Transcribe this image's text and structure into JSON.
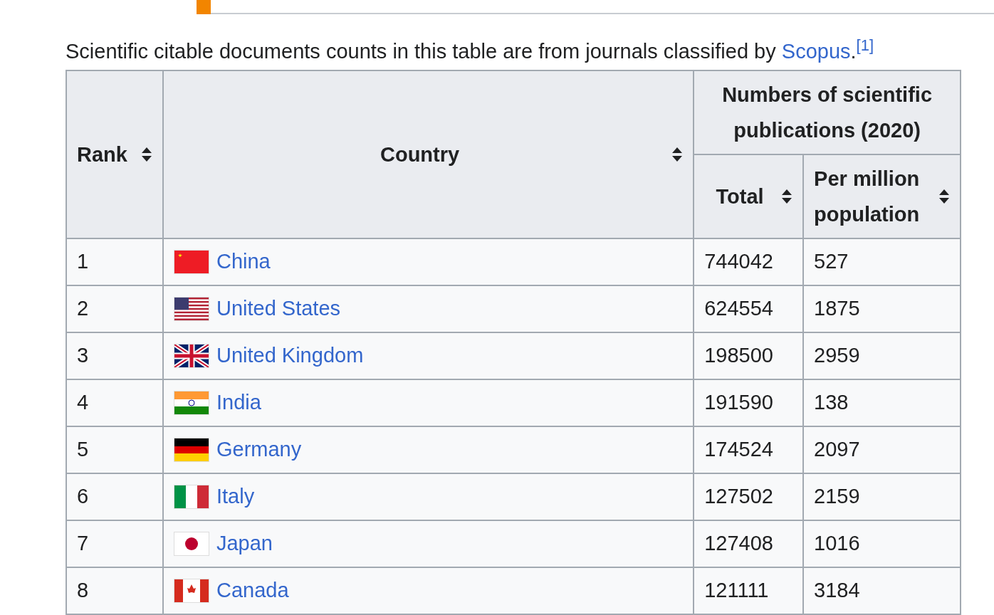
{
  "intro": {
    "text": "Scientific citable documents counts in this table are from journals classified by ",
    "link": "Scopus",
    "after": ".",
    "ref": "[1]"
  },
  "table": {
    "columns": [
      {
        "label": "Rank",
        "sortable": true
      },
      {
        "label": "Country",
        "sortable": true
      }
    ],
    "group": {
      "label": "Numbers of scientific publications (2020)",
      "columns": [
        {
          "label": "Total",
          "sortable": true
        },
        {
          "label": "Per million population",
          "sortable": true
        }
      ]
    },
    "rows": [
      {
        "rank": "1",
        "country": "China",
        "total": "744042",
        "per_million": "527"
      },
      {
        "rank": "2",
        "country": "United States",
        "total": "624554",
        "per_million": "1875"
      },
      {
        "rank": "3",
        "country": "United Kingdom",
        "total": "198500",
        "per_million": "2959"
      },
      {
        "rank": "4",
        "country": "India",
        "total": "191590",
        "per_million": "138"
      },
      {
        "rank": "5",
        "country": "Germany",
        "total": "174524",
        "per_million": "2097"
      },
      {
        "rank": "6",
        "country": "Italy",
        "total": "127502",
        "per_million": "2159"
      },
      {
        "rank": "7",
        "country": "Japan",
        "total": "127408",
        "per_million": "1016"
      },
      {
        "rank": "8",
        "country": "Canada",
        "total": "121111",
        "per_million": "3184"
      }
    ]
  }
}
